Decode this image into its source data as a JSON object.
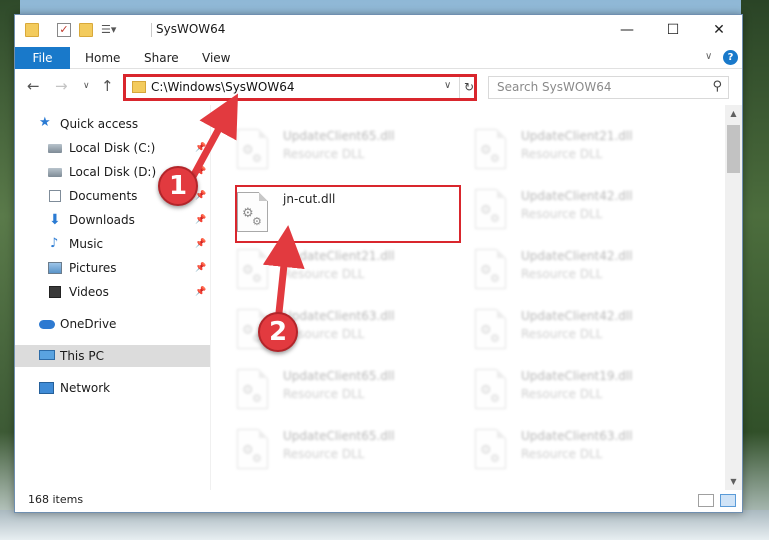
{
  "window": {
    "title": "SysWOW64",
    "minimize_glyph": "—",
    "maximize_glyph": "☐",
    "close_glyph": "✕"
  },
  "ribbon": {
    "tabs": [
      "File",
      "Home",
      "Share",
      "View"
    ],
    "help_glyph": "?"
  },
  "address": {
    "path": "C:\\Windows\\SysWOW64",
    "search_placeholder": "Search SysWOW64"
  },
  "sidebar": {
    "items": [
      {
        "label": "Quick access",
        "icon": "star-icon"
      },
      {
        "label": "Local Disk (C:)",
        "icon": "drive-icon"
      },
      {
        "label": "Local Disk (D:)",
        "icon": "drive-icon"
      },
      {
        "label": "Documents",
        "icon": "documents-icon"
      },
      {
        "label": "Downloads",
        "icon": "downloads-icon"
      },
      {
        "label": "Music",
        "icon": "music-icon"
      },
      {
        "label": "Pictures",
        "icon": "pictures-icon"
      },
      {
        "label": "Videos",
        "icon": "videos-icon"
      },
      {
        "label": "OneDrive",
        "icon": "onedrive-icon"
      },
      {
        "label": "This PC",
        "icon": "pc-icon"
      },
      {
        "label": "Network",
        "icon": "network-icon"
      }
    ]
  },
  "files": {
    "left": [
      {
        "name": "UpdateClient65.dll",
        "type": "Resource DLL"
      },
      {
        "name": "jn-cut.dll",
        "type": ""
      },
      {
        "name": "UpdateClient21.dll",
        "type": "Resource DLL"
      },
      {
        "name": "UpdateClient63.dll",
        "type": "Resource DLL"
      },
      {
        "name": "UpdateClient65.dll",
        "type": "Resource DLL"
      },
      {
        "name": "UpdateClient65.dll",
        "type": "Resource DLL"
      }
    ],
    "right": [
      {
        "name": "UpdateClient21.dll",
        "type": "Resource DLL"
      },
      {
        "name": "UpdateClient42.dll",
        "type": "Resource DLL"
      },
      {
        "name": "UpdateClient42.dll",
        "type": "Resource DLL"
      },
      {
        "name": "UpdateClient42.dll",
        "type": "Resource DLL"
      },
      {
        "name": "UpdateClient19.dll",
        "type": "Resource DLL"
      },
      {
        "name": "UpdateClient63.dll",
        "type": "Resource DLL"
      }
    ]
  },
  "status": {
    "item_count": "168 items"
  },
  "annotations": {
    "step1": "1",
    "step2": "2",
    "color": "#e23a3f"
  }
}
